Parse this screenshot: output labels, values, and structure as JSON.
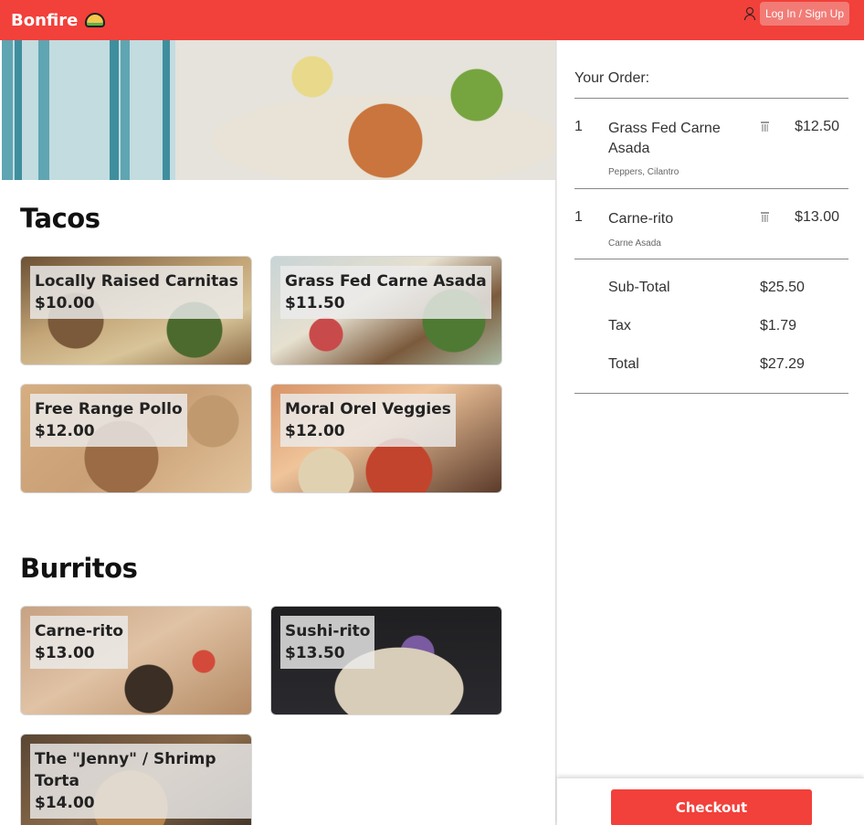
{
  "header": {
    "brand": "Bonfire",
    "brand_icon": "taco-icon",
    "login_label": "Log In / Sign Up",
    "accent_color": "#f2403a"
  },
  "menu": {
    "sections": [
      {
        "title": "Tacos",
        "items": [
          {
            "name": "Locally Raised Carnitas",
            "price": "$10.00"
          },
          {
            "name": "Grass Fed Carne Asada",
            "price": "$11.50"
          },
          {
            "name": "Free Range Pollo",
            "price": "$12.00"
          },
          {
            "name": "Moral Orel Veggies",
            "price": "$12.00"
          }
        ]
      },
      {
        "title": "Burritos",
        "items": [
          {
            "name": "Carne-rito",
            "price": "$13.00"
          },
          {
            "name": "Sushi-rito",
            "price": "$13.50"
          },
          {
            "name": "The \"Jenny\" / Shrimp Torta",
            "price": "$14.00"
          }
        ]
      }
    ]
  },
  "order": {
    "title": "Your Order:",
    "lines": [
      {
        "qty": "1",
        "name": "Grass Fed Carne Asada",
        "price": "$12.50",
        "mods": "Peppers, Cilantro"
      },
      {
        "qty": "1",
        "name": "Carne-rito",
        "price": "$13.00",
        "mods": "Carne Asada"
      }
    ],
    "subtotal_label": "Sub-Total",
    "subtotal": "$25.50",
    "tax_label": "Tax",
    "tax": "$1.79",
    "total_label": "Total",
    "total": "$27.29",
    "checkout_label": "Checkout"
  }
}
